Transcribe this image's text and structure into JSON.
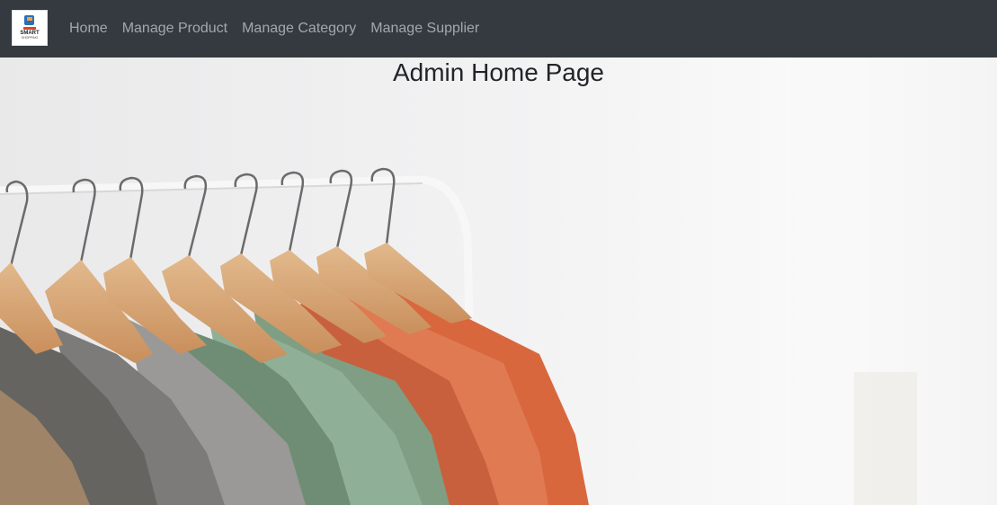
{
  "navbar": {
    "brand": {
      "icon": "store-logo-icon",
      "logo_text_line1": "SMART",
      "logo_text_line2": "SHOPPING"
    },
    "links": [
      {
        "label": "Home"
      },
      {
        "label": "Manage Product"
      },
      {
        "label": "Manage Category"
      },
      {
        "label": "Manage Supplier"
      }
    ],
    "background_color": "#343a40"
  },
  "main": {
    "title": "Admin Home Page",
    "hero_image": "clothes-on-hangers-image"
  }
}
